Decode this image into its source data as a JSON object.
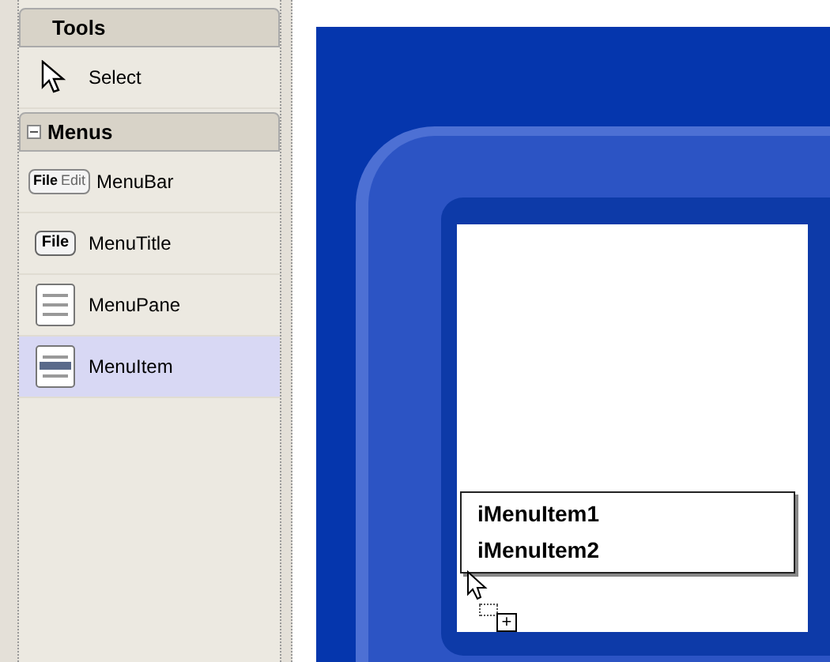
{
  "toolbox": {
    "sections": [
      {
        "title": "Tools",
        "kind": "plain",
        "items": [
          {
            "label": "Select",
            "kind": "pointer",
            "selected": false
          }
        ]
      },
      {
        "title": "Menus",
        "kind": "collapsible",
        "expanded": true,
        "items": [
          {
            "label": "MenuBar",
            "kind": "menubar",
            "selected": false
          },
          {
            "label": "MenuTitle",
            "kind": "menutitle",
            "selected": false
          },
          {
            "label": "MenuPane",
            "kind": "menupane",
            "selected": false
          },
          {
            "label": "MenuItem",
            "kind": "menuitem",
            "selected": true
          }
        ]
      }
    ]
  },
  "icon_texts": {
    "menubar": [
      "File",
      "Edit"
    ],
    "menutitle": "File"
  },
  "designer": {
    "menu_items": [
      "iMenuItem1",
      "iMenuItem2"
    ],
    "drag_add_mark": "+"
  }
}
